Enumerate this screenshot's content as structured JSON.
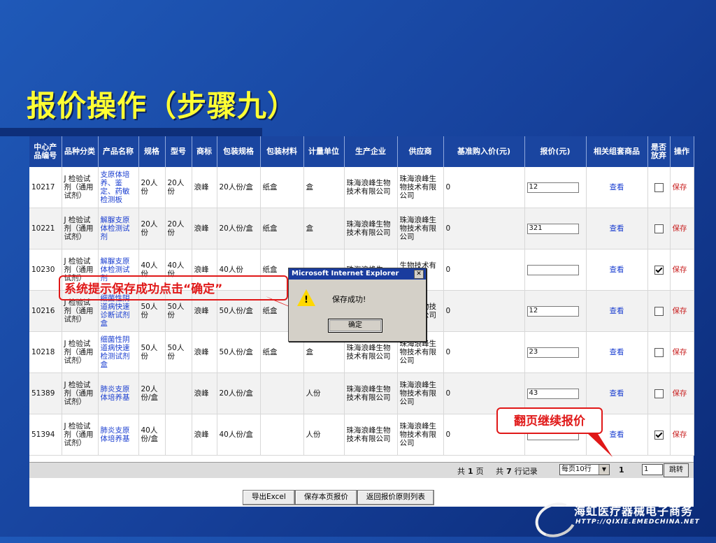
{
  "slide": {
    "title": "报价操作（步骤九）"
  },
  "table": {
    "headers": [
      "中心产品编号",
      "品种分类",
      "产品名称",
      "规格",
      "型号",
      "商标",
      "包装规格",
      "包装材料",
      "计量单位",
      "生产企业",
      "供应商",
      "基准购入价(元)",
      "报价(元)",
      "相关组套商品",
      "是否放弃",
      "操作"
    ],
    "rows": [
      {
        "code": "10217",
        "category": "J 检验试剂（通用试剂）",
        "name": "支原体培养、鉴定、药敏检测板",
        "spec": "20人份",
        "model": "20人份",
        "brand": "浪峰",
        "pack_spec": "20人份/盒",
        "pack_material": "纸盒",
        "unit": "盒",
        "manufacturer": "珠海浪峰生物技术有限公司",
        "supplier": "珠海浪峰生物技术有限公司",
        "base_price": "0",
        "quote": "12",
        "view": "查看",
        "abandon": false,
        "action": "保存"
      },
      {
        "code": "10221",
        "category": "J 检验试剂（通用试剂）",
        "name": "解脲支原体检测试剂",
        "spec": "20人份",
        "model": "20人份",
        "brand": "浪峰",
        "pack_spec": "20人份/盒",
        "pack_material": "纸盒",
        "unit": "盒",
        "manufacturer": "珠海浪峰生物技术有限公司",
        "supplier": "珠海浪峰生物技术有限公司",
        "base_price": "0",
        "quote": "321",
        "view": "查看",
        "abandon": false,
        "action": "保存"
      },
      {
        "code": "10230",
        "category": "J 检验试剂（通用试剂）",
        "name": "解脲支原体检测试剂",
        "spec": "40人份",
        "model": "40人份",
        "brand": "浪峰",
        "pack_spec": "40人份",
        "pack_material": "纸盒",
        "unit": "",
        "manufacturer": "珠海浪峰生",
        "supplier": "生物技术有限公司",
        "base_price": "0",
        "quote": "",
        "view": "查看",
        "abandon": true,
        "action": "保存"
      },
      {
        "code": "10216",
        "category": "J 检验试剂（通用试剂）",
        "name": "细菌性阴道病快速诊断试剂盒",
        "spec": "50人份",
        "model": "50人份",
        "brand": "浪峰",
        "pack_spec": "50人份/盒",
        "pack_material": "纸盒",
        "unit": "",
        "manufacturer": "",
        "supplier": "浪峰生物技术有限公司",
        "base_price": "0",
        "quote": "12",
        "view": "查看",
        "abandon": false,
        "action": "保存"
      },
      {
        "code": "10218",
        "category": "J 检验试剂（通用试剂）",
        "name": "细菌性阴道病快速检测试剂盒",
        "spec": "50人份",
        "model": "50人份",
        "brand": "浪峰",
        "pack_spec": "50人份/盒",
        "pack_material": "纸盒",
        "unit": "盒",
        "manufacturer": "珠海浪峰生物技术有限公司",
        "supplier": "珠海浪峰生物技术有限公司",
        "base_price": "0",
        "quote": "23",
        "view": "查看",
        "abandon": false,
        "action": "保存"
      },
      {
        "code": "51389",
        "category": "J 检验试剂（通用试剂）",
        "name": "肺炎支原体培养基",
        "spec": "20人份/盒",
        "model": "",
        "brand": "浪峰",
        "pack_spec": "20人份/盒",
        "pack_material": "",
        "unit": "人份",
        "manufacturer": "珠海浪峰生物技术有限公司",
        "supplier": "珠海浪峰生物技术有限公司",
        "base_price": "0",
        "quote": "43",
        "view": "查看",
        "abandon": false,
        "action": "保存"
      },
      {
        "code": "51394",
        "category": "J 检验试剂（通用试剂）",
        "name": "肺炎支原体培养基",
        "spec": "40人份/盒",
        "model": "",
        "brand": "浪峰",
        "pack_spec": "40人份/盒",
        "pack_material": "",
        "unit": "人份",
        "manufacturer": "珠海浪峰生物技术有限公司",
        "supplier": "珠海浪峰生物技术有限公司",
        "base_price": "0",
        "quote": "",
        "view": "查看",
        "abandon": true,
        "action": "保存"
      }
    ]
  },
  "pager": {
    "total_pages_prefix": "共",
    "total_pages": "1",
    "total_pages_suffix": "页",
    "total_rows_prefix": "共",
    "total_rows": "7",
    "total_rows_suffix": "行记录",
    "per_page": "每页10行",
    "current_page": "1",
    "page_input": "1",
    "jump": "跳转"
  },
  "actions": [
    "导出Excel",
    "保存本页报价",
    "返回报价原则列表"
  ],
  "dialog": {
    "title": "Microsoft Internet Explorer",
    "message": "保存成功!",
    "ok": "确定",
    "close": "✕"
  },
  "callouts": {
    "first": "系统提示保存成功点击“确定”",
    "second": "翻页继续报价"
  },
  "footer": {
    "brand": "海虹医疗器械电子商务",
    "url": "HTTP://QIXIE.EMEDCHINA.NET"
  },
  "colors": {
    "background": "#1a4fb0",
    "title": "#ffff33",
    "header": "#1a45a0",
    "link": "#1a3ed0",
    "save": "#c81e1e",
    "callout": "#e01818"
  }
}
